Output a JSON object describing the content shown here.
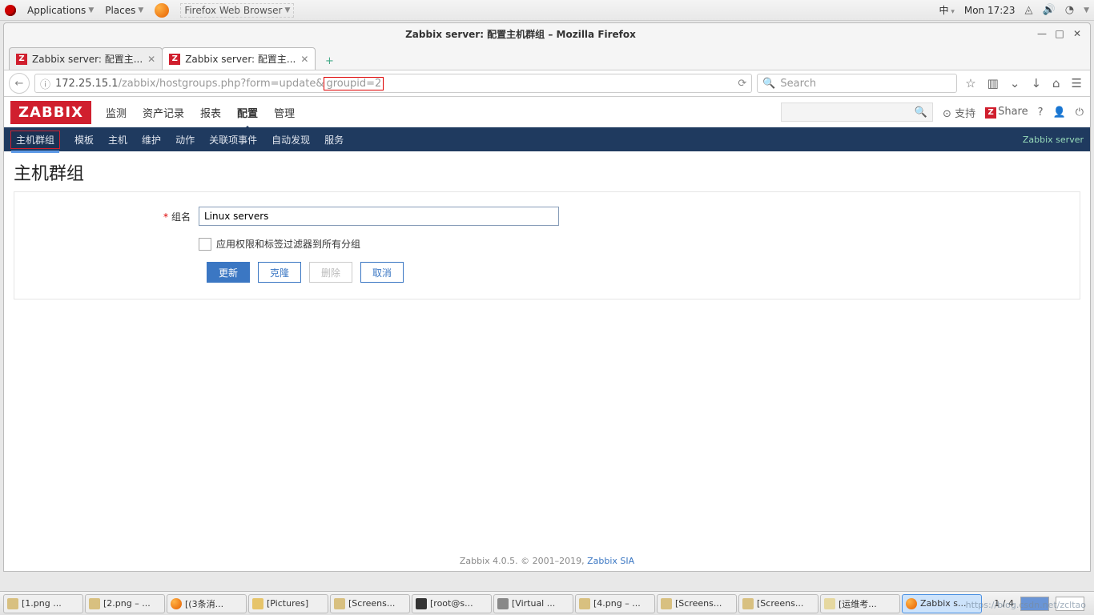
{
  "gnome": {
    "apps": "Applications",
    "places": "Places",
    "ff": "Firefox Web Browser",
    "ime": "中",
    "clock": "Mon 17:23"
  },
  "fx": {
    "title": "Zabbix server: 配置主机群组 – Mozilla Firefox",
    "tab1": "Zabbix server: 配置主...",
    "tab2": "Zabbix server: 配置主...",
    "url_host": "172.25.15.1",
    "url_path": "/zabbix/hostgroups.php?form=update&",
    "url_query_hl": "groupid=2",
    "search_ph": "Search"
  },
  "zbx": {
    "logo": "ZABBIX",
    "menu": [
      "监测",
      "资产记录",
      "报表",
      "配置",
      "管理"
    ],
    "menu_active_idx": 3,
    "tools": {
      "support": "支持",
      "share": "Share"
    },
    "submenu": [
      "主机群组",
      "模板",
      "主机",
      "维护",
      "动作",
      "关联项事件",
      "自动发现",
      "服务"
    ],
    "server": "Zabbix server",
    "heading": "主机群组",
    "form": {
      "name_label": "组名",
      "name_value": "Linux servers",
      "apply_label": "应用权限和标签过滤器到所有分组",
      "btn_update": "更新",
      "btn_clone": "克隆",
      "btn_delete": "删除",
      "btn_cancel": "取消"
    },
    "footer_text": "Zabbix 4.0.5. © 2001–2019, ",
    "footer_link": "Zabbix SIA"
  },
  "taskbar": {
    "items": [
      "[1.png ...",
      "[2.png – ...",
      "[(3条消...",
      "[Pictures]",
      "[Screens...",
      "[root@s...",
      "[Virtual ...",
      "[4.png – ...",
      "[Screens...",
      "[Screens...",
      "[运维考...",
      "Zabbix s..."
    ],
    "page": "1 / 4"
  },
  "watermark": "https://blog.csdn.net/zcltao"
}
